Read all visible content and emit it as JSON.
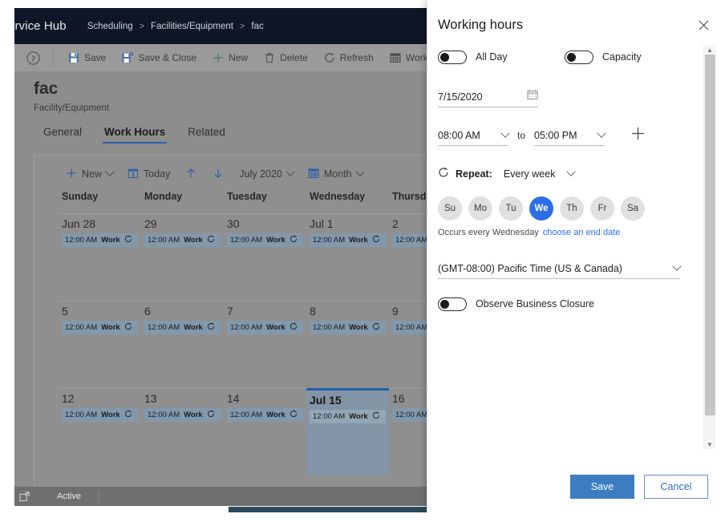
{
  "nav": {
    "app_name": "ervice Hub",
    "breadcrumb": [
      "Scheduling",
      "Facilities/Equipment",
      "fac"
    ],
    "separator": ">"
  },
  "command_bar": {
    "expand_icon": "chevron-right-circle-icon",
    "items": [
      {
        "label": "Save",
        "icon": "save-icon"
      },
      {
        "label": "Save & Close",
        "icon": "save-and-close-icon"
      },
      {
        "label": "New",
        "icon": "plus-icon"
      },
      {
        "label": "Delete",
        "icon": "trash-icon"
      },
      {
        "label": "Refresh",
        "icon": "refresh-icon"
      },
      {
        "label": "Work H",
        "icon": "calendar-grid-icon"
      }
    ]
  },
  "record": {
    "title": "fac",
    "subtitle": "Facility/Equipment"
  },
  "tabs": [
    {
      "label": "General",
      "active": false
    },
    {
      "label": "Work Hours",
      "active": true
    },
    {
      "label": "Related",
      "active": false
    }
  ],
  "calendar": {
    "toolbar": [
      {
        "label": "New",
        "icon": "plus-icon",
        "chevron": true
      },
      {
        "label": "Today",
        "icon": "calendar-today-icon",
        "chevron": false
      },
      {
        "label": "",
        "icon": "arrow-up-icon",
        "chevron": false
      },
      {
        "label": "",
        "icon": "arrow-down-icon",
        "chevron": false
      },
      {
        "label": "July 2020",
        "icon": "",
        "chevron": true
      },
      {
        "label": "Month",
        "icon": "calendar-grid-icon",
        "chevron": true
      }
    ],
    "weekday_headers": [
      "Sunday",
      "Monday",
      "Tuesday",
      "Wednesday",
      "Thursday"
    ],
    "event_time": "12:00 AM",
    "event_label": "Work",
    "event_icon": "recurrence-icon",
    "rows": [
      [
        {
          "day": "Jun 28",
          "today": false,
          "event": true
        },
        {
          "day": "29",
          "today": false,
          "event": true
        },
        {
          "day": "30",
          "today": false,
          "event": true
        },
        {
          "day": "Jul 1",
          "today": false,
          "event": true
        },
        {
          "day": "2",
          "today": false,
          "event": true
        }
      ],
      [
        {
          "day": "5",
          "today": false,
          "event": true
        },
        {
          "day": "6",
          "today": false,
          "event": true
        },
        {
          "day": "7",
          "today": false,
          "event": true
        },
        {
          "day": "8",
          "today": false,
          "event": true
        },
        {
          "day": "9",
          "today": false,
          "event": true
        }
      ],
      [
        {
          "day": "12",
          "today": false,
          "event": true
        },
        {
          "day": "13",
          "today": false,
          "event": true
        },
        {
          "day": "14",
          "today": false,
          "event": true
        },
        {
          "day": "Jul 15",
          "today": true,
          "event": true
        },
        {
          "day": "16",
          "today": false,
          "event": true
        }
      ]
    ]
  },
  "status_bar": {
    "icon": "popout-icon",
    "text": "Active"
  },
  "dialog": {
    "title": "Working hours",
    "close_icon": "close-icon",
    "toggles": [
      {
        "label": "All Day",
        "on": false
      },
      {
        "label": "Capacity",
        "on": false
      }
    ],
    "date": {
      "value": "7/15/2020",
      "icon": "calendar-picker-icon"
    },
    "time": {
      "start": "08:00 AM",
      "separator": "to",
      "end": "05:00 PM",
      "add_icon": "plus-icon"
    },
    "repeat": {
      "icon": "recurrence-icon",
      "label": "Repeat:",
      "value": "Every week"
    },
    "days": [
      {
        "label": "Su",
        "selected": false
      },
      {
        "label": "Mo",
        "selected": false
      },
      {
        "label": "Tu",
        "selected": false
      },
      {
        "label": "We",
        "selected": true
      },
      {
        "label": "Th",
        "selected": false
      },
      {
        "label": "Fr",
        "selected": false
      },
      {
        "label": "Sa",
        "selected": false
      }
    ],
    "occurs": {
      "text": "Occurs every Wednesday",
      "link": "choose an end date"
    },
    "timezone": {
      "value": "(GMT-08:00) Pacific Time (US & Canada)"
    },
    "closure_toggle": {
      "label": "Observe Business Closure",
      "on": false
    },
    "footer": {
      "save": "Save",
      "cancel": "Cancel"
    }
  },
  "colors": {
    "accent_blue": "#2b6fe8",
    "primary_button": "#3b7dc0",
    "nav_dark": "#0e1726",
    "today_border": "#1f5fa9"
  }
}
